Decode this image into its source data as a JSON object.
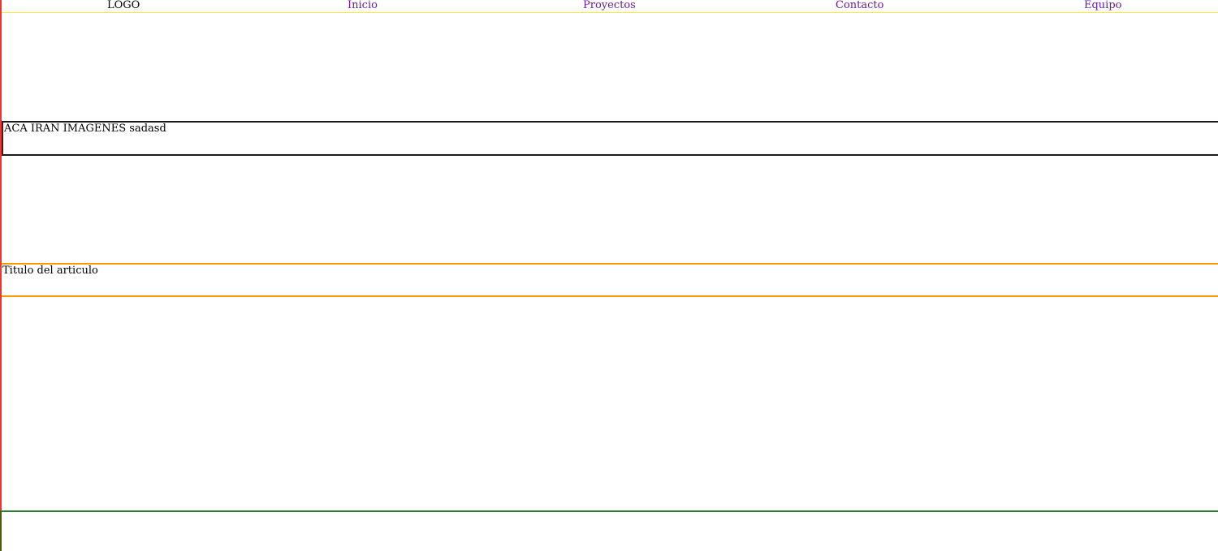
{
  "nav": {
    "logo": "LOGO",
    "links": [
      "Inicio",
      "Proyectos",
      "Contacto",
      "Equipo"
    ]
  },
  "images_section": {
    "text": "ACA IRAN IMAGENES sadasd"
  },
  "article": {
    "title": "Titulo del articulo"
  },
  "colors": {
    "page_border": "#e53935",
    "nav_border": "#ffeb3b",
    "link": "#6a1b9a",
    "images_border": "#1a1a1a",
    "article_border": "#ff9800",
    "footer_border": "#2e7d32"
  }
}
